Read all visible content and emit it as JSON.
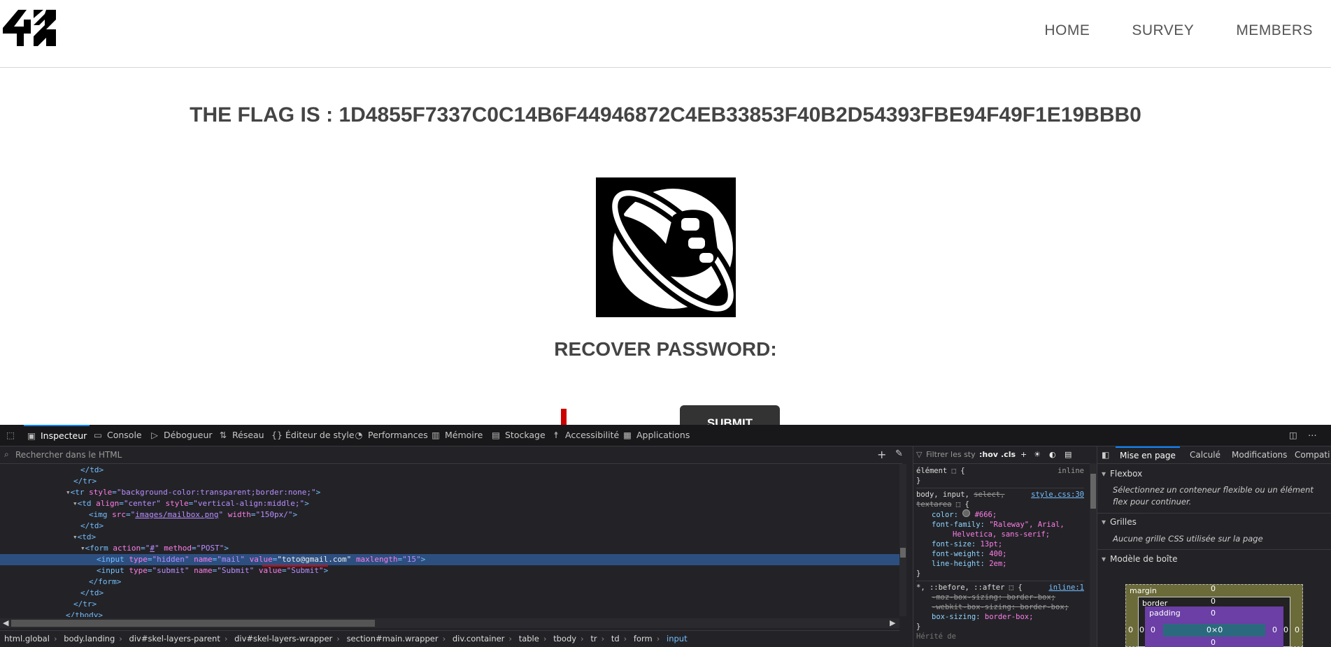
{
  "header": {
    "logo_alt": "42",
    "nav": [
      "HOME",
      "SURVEY",
      "MEMBERS"
    ]
  },
  "main": {
    "flag_text": "THE FLAG IS : 1D4855F7337C0C14B6F44946872C4EB33853F40B2D54393FBE94F49F1E19BBB0",
    "emblem_name": "hitchhiker-emblem",
    "recover_title": "RECOVER PASSWORD:",
    "submit_label": "SUBMIT"
  },
  "devtools": {
    "tabs": [
      "Inspecteur",
      "Console",
      "Débogueur",
      "Réseau",
      "Éditeur de style",
      "Performances",
      "Mémoire",
      "Stockage",
      "Accessibilité",
      "Applications"
    ],
    "search_placeholder": "Rechercher dans le HTML",
    "breadcrumbs": [
      "html.global",
      "body.landing",
      "div#skel-layers-parent",
      "div#skel-layers-wrapper",
      "section#main.wrapper",
      "div.container",
      "table",
      "tbody",
      "tr",
      "td",
      "form",
      "input"
    ],
    "rules": {
      "filter_placeholder": "Filtrer les sty",
      "hov": ":hov",
      "cls": ".cls",
      "element_selector": "élément",
      "inline": "inline",
      "rule1_selector_a": "body, input,",
      "rule1_selector_b": "select,",
      "rule1_selector_c": "textarea",
      "rule1_source": "style.css:30",
      "color_prop": "color:",
      "color_val": "#666;",
      "font_family_prop": "font-family:",
      "font_family_val": "\"Raleway\", Arial,",
      "font_family_val2": "Helvetica, sans-serif;",
      "font_size_prop": "font-size:",
      "font_size_val": "13pt;",
      "font_weight_prop": "font-weight:",
      "font_weight_val": "400;",
      "line_height_prop": "line-height:",
      "line_height_val": "2em;",
      "rule2_selector": "*, ::before, ::after",
      "rule2_source": "inline:1",
      "moz_box": "-moz-box-sizing: border-box;",
      "webkit_box": "-webkit-box-sizing: border-box;",
      "box_sizing_prop": "box-sizing:",
      "box_sizing_val": "border-box;",
      "next_section": "Hérité de"
    },
    "layout": {
      "tabs": [
        "Mise en page",
        "Calculé",
        "Modifications",
        "Compati"
      ],
      "flexbox_title": "Flexbox",
      "flexbox_text": "Sélectionnez un conteneur flexible ou un élément flex pour continuer.",
      "grid_title": "Grilles",
      "grid_text": "Aucune grille CSS utilisée sur la page",
      "boxmodel_title": "Modèle de boîte",
      "margin_label": "margin",
      "border_label": "border",
      "padding_label": "padding",
      "content_size": "0×0",
      "zero": "0"
    }
  },
  "colors": {
    "devtools_bg": "#232327",
    "selected_row": "#2d4f80",
    "accent": "#0a84ff"
  }
}
